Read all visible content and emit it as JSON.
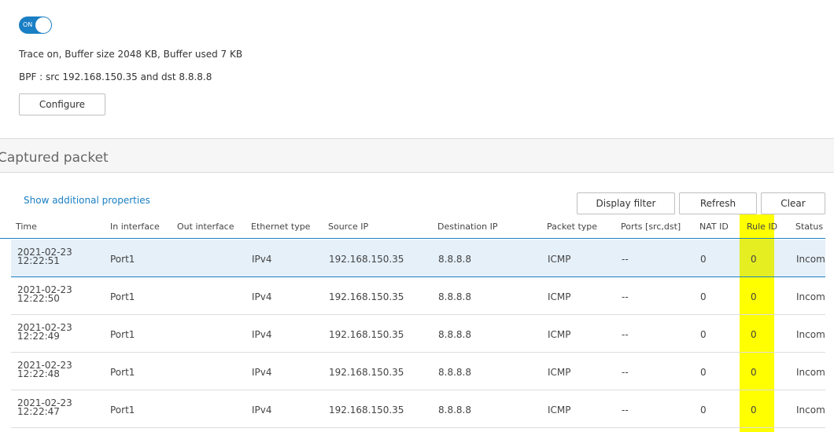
{
  "trace": {
    "toggle_label": "ON",
    "status_text": "Trace on, Buffer size 2048 KB, Buffer used 7 KB",
    "bpf_text": "BPF : src 192.168.150.35 and dst 8.8.8.8",
    "configure_label": "Configure"
  },
  "section": {
    "title": "Captured packet"
  },
  "toolbar": {
    "show_props_label": "Show additional properties",
    "display_filter_label": "Display filter",
    "refresh_label": "Refresh",
    "clear_label": "Clear"
  },
  "colors": {
    "accent": "#1a7fc4",
    "highlight": "#ffff00",
    "selected_row": "#e5f0f9"
  },
  "table": {
    "columns": [
      "Time",
      "In interface",
      "Out interface",
      "Ethernet type",
      "Source IP",
      "Destination IP",
      "Packet type",
      "Ports [src,dst]",
      "NAT ID",
      "Rule ID",
      "Status"
    ],
    "rows": [
      {
        "date": "2021-02-23",
        "time": "12:22:51",
        "in_if": "Port1",
        "out_if": "",
        "eth": "IPv4",
        "src": "192.168.150.35",
        "dst": "8.8.8.8",
        "ptype": "ICMP",
        "ports": "--",
        "nat": "0",
        "rule": "0",
        "status": "Incom"
      },
      {
        "date": "2021-02-23",
        "time": "12:22:50",
        "in_if": "Port1",
        "out_if": "",
        "eth": "IPv4",
        "src": "192.168.150.35",
        "dst": "8.8.8.8",
        "ptype": "ICMP",
        "ports": "--",
        "nat": "0",
        "rule": "0",
        "status": "Incom"
      },
      {
        "date": "2021-02-23",
        "time": "12:22:49",
        "in_if": "Port1",
        "out_if": "",
        "eth": "IPv4",
        "src": "192.168.150.35",
        "dst": "8.8.8.8",
        "ptype": "ICMP",
        "ports": "--",
        "nat": "0",
        "rule": "0",
        "status": "Incom"
      },
      {
        "date": "2021-02-23",
        "time": "12:22:48",
        "in_if": "Port1",
        "out_if": "",
        "eth": "IPv4",
        "src": "192.168.150.35",
        "dst": "8.8.8.8",
        "ptype": "ICMP",
        "ports": "--",
        "nat": "0",
        "rule": "0",
        "status": "Incom"
      },
      {
        "date": "2021-02-23",
        "time": "12:22:47",
        "in_if": "Port1",
        "out_if": "",
        "eth": "IPv4",
        "src": "192.168.150.35",
        "dst": "8.8.8.8",
        "ptype": "ICMP",
        "ports": "--",
        "nat": "0",
        "rule": "0",
        "status": "Incom"
      }
    ]
  }
}
